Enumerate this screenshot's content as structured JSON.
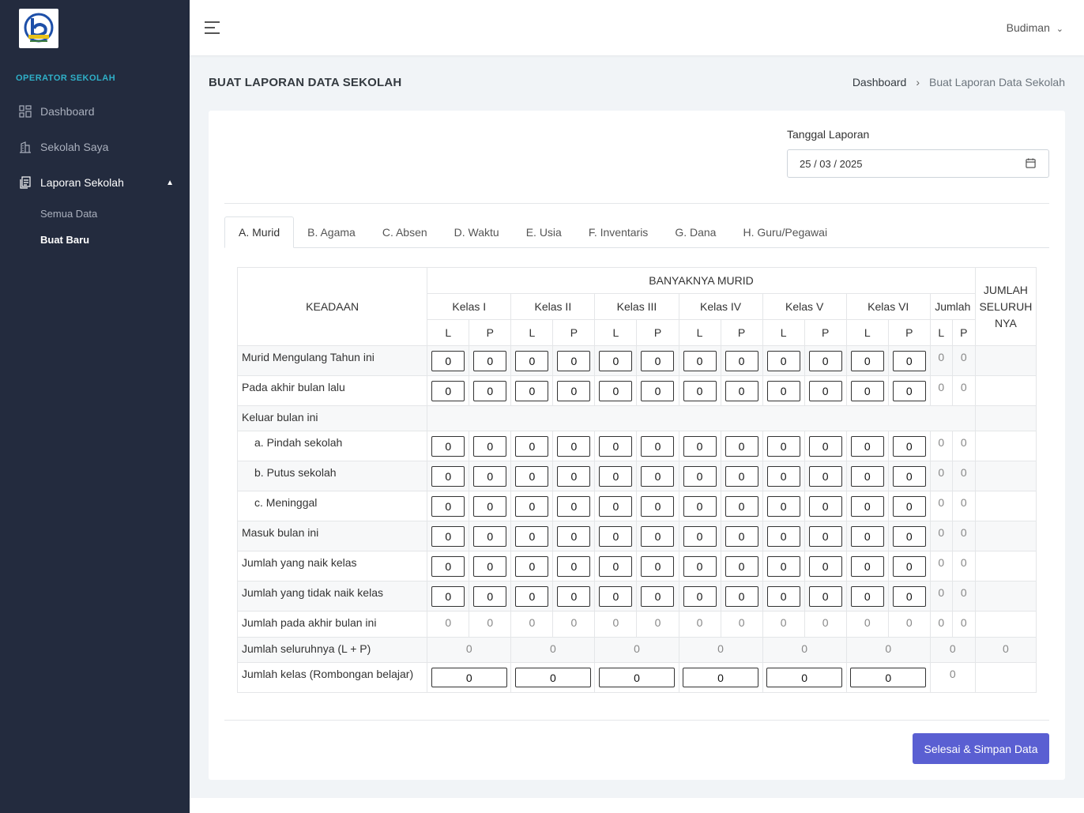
{
  "sidebar": {
    "section_title": "OPERATOR SEKOLAH",
    "items": [
      {
        "label": "Dashboard",
        "icon": "grid-icon"
      },
      {
        "label": "Sekolah Saya",
        "icon": "building-icon"
      },
      {
        "label": "Laporan Sekolah",
        "icon": "document-icon"
      }
    ],
    "subitems": [
      {
        "label": "Semua Data"
      },
      {
        "label": "Buat Baru"
      }
    ]
  },
  "topbar": {
    "user_name": "Budiman",
    "user_chevron": "⌄"
  },
  "page": {
    "title": "BUAT LAPORAN DATA SEKOLAH"
  },
  "breadcrumb": {
    "home": "Dashboard",
    "separator": "›",
    "current": "Buat Laporan Data Sekolah"
  },
  "form": {
    "date_label": "Tanggal Laporan",
    "date_value": "25 / 03 / 2025"
  },
  "tabs": [
    {
      "label": "A. Murid"
    },
    {
      "label": "B. Agama"
    },
    {
      "label": "C. Absen"
    },
    {
      "label": "D. Waktu"
    },
    {
      "label": "E. Usia"
    },
    {
      "label": "F. Inventaris"
    },
    {
      "label": "G. Dana"
    },
    {
      "label": "H. Guru/Pegawai"
    }
  ],
  "table": {
    "header_keadaan": "KEADAAN",
    "header_banyaknya": "BANYAKNYA MURID",
    "header_jumlah_seluruh": "JUMLAH SELURUH NYA",
    "header_jumlah_seluruh_lines": [
      "JUMLAH",
      "SELURUH",
      "NYA"
    ],
    "header_jumlah": "Jumlah",
    "classes": [
      "Kelas I",
      "Kelas II",
      "Kelas III",
      "Kelas IV",
      "Kelas V",
      "Kelas VI"
    ],
    "l_label": "L",
    "p_label": "P",
    "input_rows": [
      {
        "label": "Murid Mengulang Tahun ini",
        "values": [
          "0",
          "0",
          "0",
          "0",
          "0",
          "0",
          "0",
          "0",
          "0",
          "0",
          "0",
          "0"
        ],
        "sum_l": "0",
        "sum_p": "0"
      },
      {
        "label": "Pada akhir bulan lalu",
        "values": [
          "0",
          "0",
          "0",
          "0",
          "0",
          "0",
          "0",
          "0",
          "0",
          "0",
          "0",
          "0"
        ],
        "sum_l": "0",
        "sum_p": "0"
      }
    ],
    "keluar_label": "Keluar bulan ini",
    "keluar_rows": [
      {
        "label": "a. Pindah sekolah",
        "values": [
          "0",
          "0",
          "0",
          "0",
          "0",
          "0",
          "0",
          "0",
          "0",
          "0",
          "0",
          "0"
        ],
        "sum_l": "0",
        "sum_p": "0"
      },
      {
        "label": "b. Putus sekolah",
        "values": [
          "0",
          "0",
          "0",
          "0",
          "0",
          "0",
          "0",
          "0",
          "0",
          "0",
          "0",
          "0"
        ],
        "sum_l": "0",
        "sum_p": "0"
      },
      {
        "label": "c. Meninggal",
        "values": [
          "0",
          "0",
          "0",
          "0",
          "0",
          "0",
          "0",
          "0",
          "0",
          "0",
          "0",
          "0"
        ],
        "sum_l": "0",
        "sum_p": "0"
      }
    ],
    "more_rows": [
      {
        "label": "Masuk bulan ini",
        "values": [
          "0",
          "0",
          "0",
          "0",
          "0",
          "0",
          "0",
          "0",
          "0",
          "0",
          "0",
          "0"
        ],
        "sum_l": "0",
        "sum_p": "0"
      },
      {
        "label": "Jumlah yang naik kelas",
        "values": [
          "0",
          "0",
          "0",
          "0",
          "0",
          "0",
          "0",
          "0",
          "0",
          "0",
          "0",
          "0"
        ],
        "sum_l": "0",
        "sum_p": "0"
      },
      {
        "label": "Jumlah yang tidak naik kelas",
        "values": [
          "0",
          "0",
          "0",
          "0",
          "0",
          "0",
          "0",
          "0",
          "0",
          "0",
          "0",
          "0"
        ],
        "sum_l": "0",
        "sum_p": "0"
      }
    ],
    "akhir_row": {
      "label": "Jumlah pada akhir bulan ini",
      "values": [
        "0",
        "0",
        "0",
        "0",
        "0",
        "0",
        "0",
        "0",
        "0",
        "0",
        "0",
        "0"
      ],
      "sum_l": "0",
      "sum_p": "0"
    },
    "seluruh_row": {
      "label": "Jumlah seluruhnya (L + P)",
      "values": [
        "0",
        "0",
        "0",
        "0",
        "0",
        "0"
      ],
      "jumlah": "0",
      "total": "0"
    },
    "rombel_row": {
      "label": "Jumlah kelas (Rombongan belajar)",
      "values": [
        "0",
        "0",
        "0",
        "0",
        "0",
        "0"
      ],
      "jumlah": "0"
    }
  },
  "actions": {
    "save_label": "Selesai & Simpan Data"
  },
  "colors": {
    "sidebar_bg": "#232b3e",
    "accent": "#5a5fd2",
    "section_title": "#2fb0c8"
  }
}
